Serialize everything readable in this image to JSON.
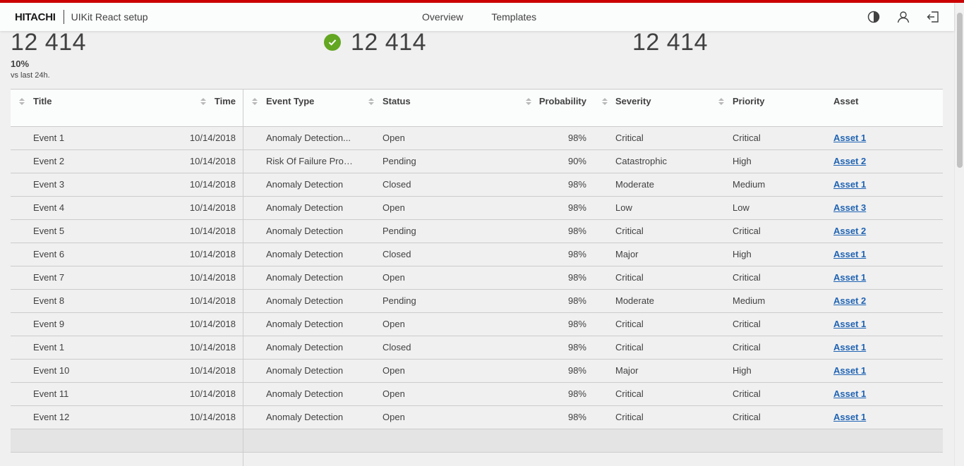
{
  "header": {
    "logo": "HITACHI",
    "app_name": "UIKit React setup",
    "nav": [
      "Overview",
      "Templates"
    ],
    "actions": [
      "theme-icon",
      "user-icon",
      "logout-icon"
    ]
  },
  "kpis": [
    {
      "value": "12 414",
      "trend": "10%",
      "subtitle": "vs last 24h."
    },
    {
      "value": "12 414",
      "status_icon": "check-circle-icon"
    },
    {
      "value": "12 414"
    }
  ],
  "table": {
    "columns": [
      "Title",
      "Time",
      "Event Type",
      "Status",
      "Probability",
      "Severity",
      "Priority",
      "Asset"
    ],
    "rows": [
      [
        "Event 1",
        "10/14/2018",
        "Anomaly Detection...",
        "Open",
        "98%",
        "Critical",
        "Critical",
        "Asset 1"
      ],
      [
        "Event 2",
        "10/14/2018",
        "Risk Of Failure Prof...",
        "Pending",
        "90%",
        "Catastrophic",
        "High",
        "Asset 2"
      ],
      [
        "Event 3",
        "10/14/2018",
        "Anomaly Detection",
        "Closed",
        "98%",
        "Moderate",
        "Medium",
        "Asset 1"
      ],
      [
        "Event 4",
        "10/14/2018",
        "Anomaly Detection",
        "Open",
        "98%",
        "Low",
        "Low",
        "Asset 3"
      ],
      [
        "Event 5",
        "10/14/2018",
        "Anomaly Detection",
        "Pending",
        "98%",
        "Critical",
        "Critical",
        "Asset 2"
      ],
      [
        "Event 6",
        "10/14/2018",
        "Anomaly Detection",
        "Closed",
        "98%",
        "Major",
        "High",
        "Asset 1"
      ],
      [
        "Event 7",
        "10/14/2018",
        "Anomaly Detection",
        "Open",
        "98%",
        "Critical",
        "Critical",
        "Asset 1"
      ],
      [
        "Event 8",
        "10/14/2018",
        "Anomaly Detection",
        "Pending",
        "98%",
        "Moderate",
        "Medium",
        "Asset 2"
      ],
      [
        "Event 9",
        "10/14/2018",
        "Anomaly Detection",
        "Open",
        "98%",
        "Critical",
        "Critical",
        "Asset 1"
      ],
      [
        "Event 1",
        "10/14/2018",
        "Anomaly Detection",
        "Closed",
        "98%",
        "Critical",
        "Critical",
        "Asset 1"
      ],
      [
        "Event 10",
        "10/14/2018",
        "Anomaly Detection",
        "Open",
        "98%",
        "Major",
        "High",
        "Asset 1"
      ],
      [
        "Event 11",
        "10/14/2018",
        "Anomaly Detection",
        "Open",
        "98%",
        "Critical",
        "Critical",
        "Asset 1"
      ],
      [
        "Event 12",
        "10/14/2018",
        "Anomaly Detection",
        "Open",
        "98%",
        "Critical",
        "Critical",
        "Asset 1"
      ]
    ]
  },
  "colors": {
    "accent_bar": "#cc0000",
    "success": "#63a621",
    "link": "#2064b4"
  }
}
